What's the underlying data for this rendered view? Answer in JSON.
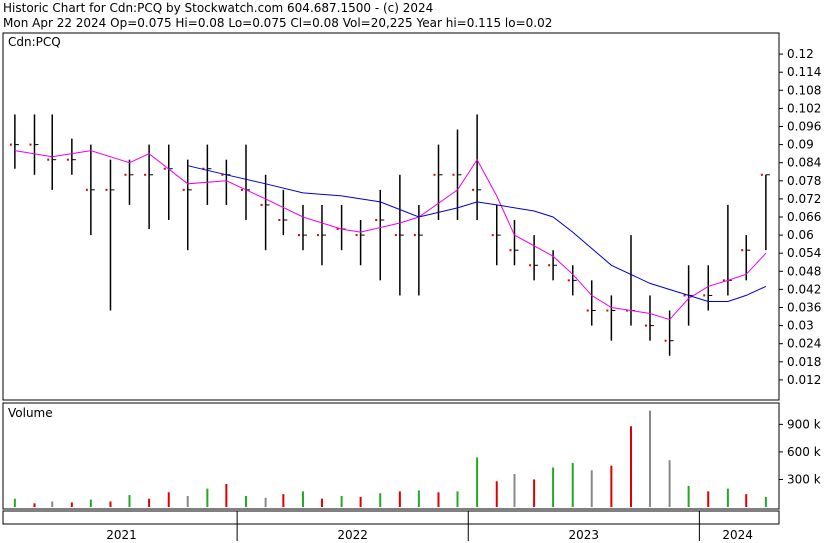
{
  "header": {
    "line1": "Historic Chart for Cdn:PCQ by Stockwatch.com 604.687.1500 - (c) 2024",
    "line2": "Mon Apr 22 2024   Op=0.075  Hi=0.08   Lo=0.075   Cl=0.08   Vol=20,225   Year hi=0.115   lo=0.02"
  },
  "colors": {
    "bar": "#000000",
    "dot": "#dd0000",
    "ma_short": "#ee00ee",
    "ma_long": "#0000cc",
    "vol_up": "#22aa22",
    "vol_down": "#dd0000",
    "vol_flat": "#888888"
  },
  "chart_data": [
    {
      "type": "line",
      "title": "Cdn:PCQ",
      "y_axis": {
        "range": [
          0.006,
          0.126
        ],
        "ticks": [
          "0.12",
          "0.114",
          "0.108",
          "0.102",
          "0.096",
          "0.09",
          "0.084",
          "0.078",
          "0.072",
          "0.066",
          "0.06",
          "0.054",
          "0.048",
          "0.042",
          "0.036",
          "0.03",
          "0.024",
          "0.018",
          "0.012"
        ],
        "side": "right"
      },
      "x_axis": {
        "labels": [
          "2021",
          "2022",
          "2023",
          "2024"
        ]
      },
      "grid": false,
      "series": [
        {
          "kind": "price_hl",
          "points": [
            {
              "d": "2021-01",
              "lo": 0.082,
              "hi": 0.1,
              "c": 0.09
            },
            {
              "d": "2021-02",
              "lo": 0.08,
              "hi": 0.1,
              "c": 0.09
            },
            {
              "d": "2021-03",
              "lo": 0.075,
              "hi": 0.1,
              "c": 0.085
            },
            {
              "d": "2021-04",
              "lo": 0.08,
              "hi": 0.092,
              "c": 0.085
            },
            {
              "d": "2021-05",
              "lo": 0.06,
              "hi": 0.09,
              "c": 0.075
            },
            {
              "d": "2021-06",
              "lo": 0.035,
              "hi": 0.085,
              "c": 0.075
            },
            {
              "d": "2021-07",
              "lo": 0.07,
              "hi": 0.085,
              "c": 0.08
            },
            {
              "d": "2021-08",
              "lo": 0.062,
              "hi": 0.09,
              "c": 0.08
            },
            {
              "d": "2021-09",
              "lo": 0.065,
              "hi": 0.09,
              "c": 0.082
            },
            {
              "d": "2021-10",
              "lo": 0.055,
              "hi": 0.085,
              "c": 0.075
            },
            {
              "d": "2021-11",
              "lo": 0.07,
              "hi": 0.09,
              "c": 0.082
            },
            {
              "d": "2021-12",
              "lo": 0.07,
              "hi": 0.085,
              "c": 0.08
            },
            {
              "d": "2022-01",
              "lo": 0.065,
              "hi": 0.09,
              "c": 0.075
            },
            {
              "d": "2022-02",
              "lo": 0.055,
              "hi": 0.08,
              "c": 0.07
            },
            {
              "d": "2022-03",
              "lo": 0.06,
              "hi": 0.075,
              "c": 0.065
            },
            {
              "d": "2022-04",
              "lo": 0.055,
              "hi": 0.07,
              "c": 0.06
            },
            {
              "d": "2022-05",
              "lo": 0.05,
              "hi": 0.07,
              "c": 0.06
            },
            {
              "d": "2022-06",
              "lo": 0.055,
              "hi": 0.07,
              "c": 0.062
            },
            {
              "d": "2022-07",
              "lo": 0.05,
              "hi": 0.065,
              "c": 0.06
            },
            {
              "d": "2022-08",
              "lo": 0.045,
              "hi": 0.075,
              "c": 0.065
            },
            {
              "d": "2022-09",
              "lo": 0.04,
              "hi": 0.08,
              "c": 0.06
            },
            {
              "d": "2022-10",
              "lo": 0.04,
              "hi": 0.07,
              "c": 0.06
            },
            {
              "d": "2022-11",
              "lo": 0.065,
              "hi": 0.09,
              "c": 0.08
            },
            {
              "d": "2022-12",
              "lo": 0.065,
              "hi": 0.095,
              "c": 0.08
            },
            {
              "d": "2023-01",
              "lo": 0.065,
              "hi": 0.1,
              "c": 0.075
            },
            {
              "d": "2023-02",
              "lo": 0.05,
              "hi": 0.07,
              "c": 0.06
            },
            {
              "d": "2023-03",
              "lo": 0.05,
              "hi": 0.065,
              "c": 0.055
            },
            {
              "d": "2023-04",
              "lo": 0.045,
              "hi": 0.06,
              "c": 0.05
            },
            {
              "d": "2023-05",
              "lo": 0.045,
              "hi": 0.055,
              "c": 0.05
            },
            {
              "d": "2023-06",
              "lo": 0.04,
              "hi": 0.05,
              "c": 0.045
            },
            {
              "d": "2023-07",
              "lo": 0.03,
              "hi": 0.045,
              "c": 0.035
            },
            {
              "d": "2023-08",
              "lo": 0.025,
              "hi": 0.04,
              "c": 0.035
            },
            {
              "d": "2023-09",
              "lo": 0.03,
              "hi": 0.06,
              "c": 0.035
            },
            {
              "d": "2023-10",
              "lo": 0.025,
              "hi": 0.04,
              "c": 0.03
            },
            {
              "d": "2023-11",
              "lo": 0.02,
              "hi": 0.035,
              "c": 0.025
            },
            {
              "d": "2023-12",
              "lo": 0.03,
              "hi": 0.05,
              "c": 0.04
            },
            {
              "d": "2024-01",
              "lo": 0.035,
              "hi": 0.05,
              "c": 0.04
            },
            {
              "d": "2024-02",
              "lo": 0.04,
              "hi": 0.07,
              "c": 0.045
            },
            {
              "d": "2024-03",
              "lo": 0.045,
              "hi": 0.06,
              "c": 0.055
            },
            {
              "d": "2024-04",
              "lo": 0.055,
              "hi": 0.08,
              "c": 0.08
            }
          ]
        },
        {
          "kind": "ma_short",
          "points": [
            {
              "d": "2021-01",
              "v": 0.088
            },
            {
              "d": "2021-03",
              "v": 0.086
            },
            {
              "d": "2021-05",
              "v": 0.088
            },
            {
              "d": "2021-07",
              "v": 0.084
            },
            {
              "d": "2021-08",
              "v": 0.087
            },
            {
              "d": "2021-10",
              "v": 0.077
            },
            {
              "d": "2021-12",
              "v": 0.078
            },
            {
              "d": "2022-02",
              "v": 0.072
            },
            {
              "d": "2022-04",
              "v": 0.066
            },
            {
              "d": "2022-06",
              "v": 0.062
            },
            {
              "d": "2022-07",
              "v": 0.061
            },
            {
              "d": "2022-09",
              "v": 0.064
            },
            {
              "d": "2022-10",
              "v": 0.066
            },
            {
              "d": "2022-12",
              "v": 0.075
            },
            {
              "d": "2023-01",
              "v": 0.085
            },
            {
              "d": "2023-02",
              "v": 0.073
            },
            {
              "d": "2023-03",
              "v": 0.06
            },
            {
              "d": "2023-05",
              "v": 0.053
            },
            {
              "d": "2023-06",
              "v": 0.047
            },
            {
              "d": "2023-07",
              "v": 0.04
            },
            {
              "d": "2023-08",
              "v": 0.036
            },
            {
              "d": "2023-09",
              "v": 0.035
            },
            {
              "d": "2023-10",
              "v": 0.034
            },
            {
              "d": "2023-11",
              "v": 0.032
            },
            {
              "d": "2023-12",
              "v": 0.039
            },
            {
              "d": "2024-01",
              "v": 0.043
            },
            {
              "d": "2024-02",
              "v": 0.045
            },
            {
              "d": "2024-03",
              "v": 0.047
            },
            {
              "d": "2024-04",
              "v": 0.054
            }
          ]
        },
        {
          "kind": "ma_long",
          "points": [
            {
              "d": "2021-10",
              "v": 0.083
            },
            {
              "d": "2021-12",
              "v": 0.08
            },
            {
              "d": "2022-02",
              "v": 0.077
            },
            {
              "d": "2022-04",
              "v": 0.074
            },
            {
              "d": "2022-06",
              "v": 0.073
            },
            {
              "d": "2022-08",
              "v": 0.071
            },
            {
              "d": "2022-10",
              "v": 0.066
            },
            {
              "d": "2022-12",
              "v": 0.069
            },
            {
              "d": "2023-01",
              "v": 0.071
            },
            {
              "d": "2023-02",
              "v": 0.07
            },
            {
              "d": "2023-04",
              "v": 0.068
            },
            {
              "d": "2023-05",
              "v": 0.066
            },
            {
              "d": "2023-06",
              "v": 0.061
            },
            {
              "d": "2023-08",
              "v": 0.05
            },
            {
              "d": "2023-10",
              "v": 0.044
            },
            {
              "d": "2023-12",
              "v": 0.04
            },
            {
              "d": "2024-01",
              "v": 0.038
            },
            {
              "d": "2024-02",
              "v": 0.038
            },
            {
              "d": "2024-03",
              "v": 0.04
            },
            {
              "d": "2024-04",
              "v": 0.043
            }
          ]
        }
      ]
    },
    {
      "type": "bar",
      "title": "Volume",
      "y_axis": {
        "range": [
          0,
          1100000
        ],
        "ticks": [
          "900 k",
          "600 k",
          "300 k"
        ],
        "side": "right"
      },
      "x_axis": {
        "labels": [
          "2021",
          "2022",
          "2023",
          "2024"
        ]
      },
      "bars": [
        {
          "d": "2021-01",
          "v": 90000,
          "c": "up"
        },
        {
          "d": "2021-02",
          "v": 40000,
          "c": "down"
        },
        {
          "d": "2021-03",
          "v": 60000,
          "c": "flat"
        },
        {
          "d": "2021-04",
          "v": 50000,
          "c": "down"
        },
        {
          "d": "2021-05",
          "v": 80000,
          "c": "up"
        },
        {
          "d": "2021-06",
          "v": 60000,
          "c": "down"
        },
        {
          "d": "2021-07",
          "v": 130000,
          "c": "up"
        },
        {
          "d": "2021-08",
          "v": 90000,
          "c": "down"
        },
        {
          "d": "2021-09",
          "v": 160000,
          "c": "down"
        },
        {
          "d": "2021-10",
          "v": 120000,
          "c": "flat"
        },
        {
          "d": "2021-11",
          "v": 200000,
          "c": "up"
        },
        {
          "d": "2021-12",
          "v": 250000,
          "c": "down"
        },
        {
          "d": "2022-01",
          "v": 120000,
          "c": "up"
        },
        {
          "d": "2022-02",
          "v": 100000,
          "c": "flat"
        },
        {
          "d": "2022-03",
          "v": 140000,
          "c": "down"
        },
        {
          "d": "2022-04",
          "v": 170000,
          "c": "up"
        },
        {
          "d": "2022-05",
          "v": 90000,
          "c": "down"
        },
        {
          "d": "2022-06",
          "v": 120000,
          "c": "up"
        },
        {
          "d": "2022-07",
          "v": 110000,
          "c": "down"
        },
        {
          "d": "2022-08",
          "v": 150000,
          "c": "up"
        },
        {
          "d": "2022-09",
          "v": 170000,
          "c": "down"
        },
        {
          "d": "2022-10",
          "v": 180000,
          "c": "up"
        },
        {
          "d": "2022-11",
          "v": 160000,
          "c": "down"
        },
        {
          "d": "2022-12",
          "v": 170000,
          "c": "up"
        },
        {
          "d": "2023-01",
          "v": 540000,
          "c": "up"
        },
        {
          "d": "2023-02",
          "v": 280000,
          "c": "down"
        },
        {
          "d": "2023-03",
          "v": 360000,
          "c": "flat"
        },
        {
          "d": "2023-04",
          "v": 300000,
          "c": "down"
        },
        {
          "d": "2023-05",
          "v": 430000,
          "c": "up"
        },
        {
          "d": "2023-06",
          "v": 480000,
          "c": "up"
        },
        {
          "d": "2023-07",
          "v": 400000,
          "c": "flat"
        },
        {
          "d": "2023-08",
          "v": 450000,
          "c": "down"
        },
        {
          "d": "2023-09",
          "v": 880000,
          "c": "down"
        },
        {
          "d": "2023-10",
          "v": 1050000,
          "c": "flat"
        },
        {
          "d": "2023-11",
          "v": 510000,
          "c": "flat"
        },
        {
          "d": "2023-12",
          "v": 230000,
          "c": "up"
        },
        {
          "d": "2024-01",
          "v": 170000,
          "c": "down"
        },
        {
          "d": "2024-02",
          "v": 200000,
          "c": "up"
        },
        {
          "d": "2024-03",
          "v": 140000,
          "c": "down"
        },
        {
          "d": "2024-04",
          "v": 110000,
          "c": "up"
        }
      ]
    }
  ]
}
